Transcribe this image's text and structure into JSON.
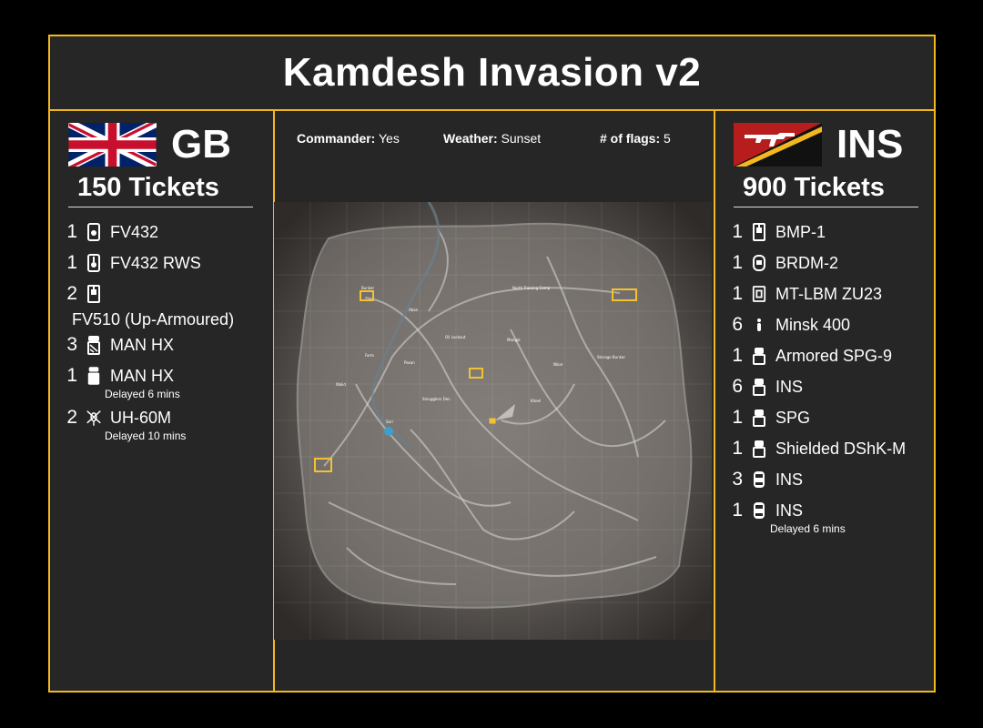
{
  "title": "Kamdesh Invasion v2",
  "colors": {
    "accent": "#f2b81e",
    "panel": "#262626"
  },
  "left": {
    "faction": "GB",
    "flag_icon": "union-jack-flag",
    "tickets": "150 Tickets",
    "vehicles": [
      {
        "count": "1",
        "icon": "apc-icon",
        "name": "FV432"
      },
      {
        "count": "1",
        "icon": "apc-rws-icon",
        "name": "FV432 RWS"
      },
      {
        "count": "2",
        "icon": "ifv-icon",
        "name": "FV510 (Up-Armoured)"
      },
      {
        "count": "3",
        "icon": "truck-icon",
        "name": "MAN HX"
      },
      {
        "count": "1",
        "icon": "logistics-truck-icon",
        "name": "MAN HX",
        "delay": "Delayed 6 mins"
      },
      {
        "count": "2",
        "icon": "helicopter-icon",
        "name": "UH-60M",
        "delay": "Delayed 10 mins"
      }
    ]
  },
  "right": {
    "faction": "INS",
    "flag_icon": "insurgent-flag",
    "tickets": "900 Tickets",
    "vehicles": [
      {
        "count": "1",
        "icon": "ifv-icon",
        "name": "BMP-1"
      },
      {
        "count": "1",
        "icon": "recon-vehicle-icon",
        "name": "BRDM-2"
      },
      {
        "count": "1",
        "icon": "aa-vehicle-icon",
        "name": "MT-LBM ZU23"
      },
      {
        "count": "6",
        "icon": "motorbike-icon",
        "name": "Minsk 400"
      },
      {
        "count": "1",
        "icon": "technical-icon",
        "name": "Armored SPG-9"
      },
      {
        "count": "6",
        "icon": "technical-icon",
        "name": "INS"
      },
      {
        "count": "1",
        "icon": "technical-icon",
        "name": "SPG"
      },
      {
        "count": "1",
        "icon": "technical-icon",
        "name": "Shielded DShK-M"
      },
      {
        "count": "3",
        "icon": "car-icon",
        "name": "INS"
      },
      {
        "count": "1",
        "icon": "car-icon",
        "name": "INS",
        "delay": "Delayed 6 mins"
      }
    ]
  },
  "info": {
    "commander_label": "Commander:",
    "commander_value": "Yes",
    "weather_label": "Weather:",
    "weather_value": "Sunset",
    "flags_label": "# of flags:",
    "flags_value": "5"
  },
  "map": {
    "image": "kamdesh-map",
    "locations": [
      "Bunker",
      "Aban",
      "North Training Camp",
      "Ammo",
      "Oil Lookout",
      "Mangol",
      "Storage Bunker",
      "Farm",
      "Pasan",
      "Nikar",
      "Smugglers Den",
      "Kheel",
      "Walid",
      "Sari"
    ]
  }
}
